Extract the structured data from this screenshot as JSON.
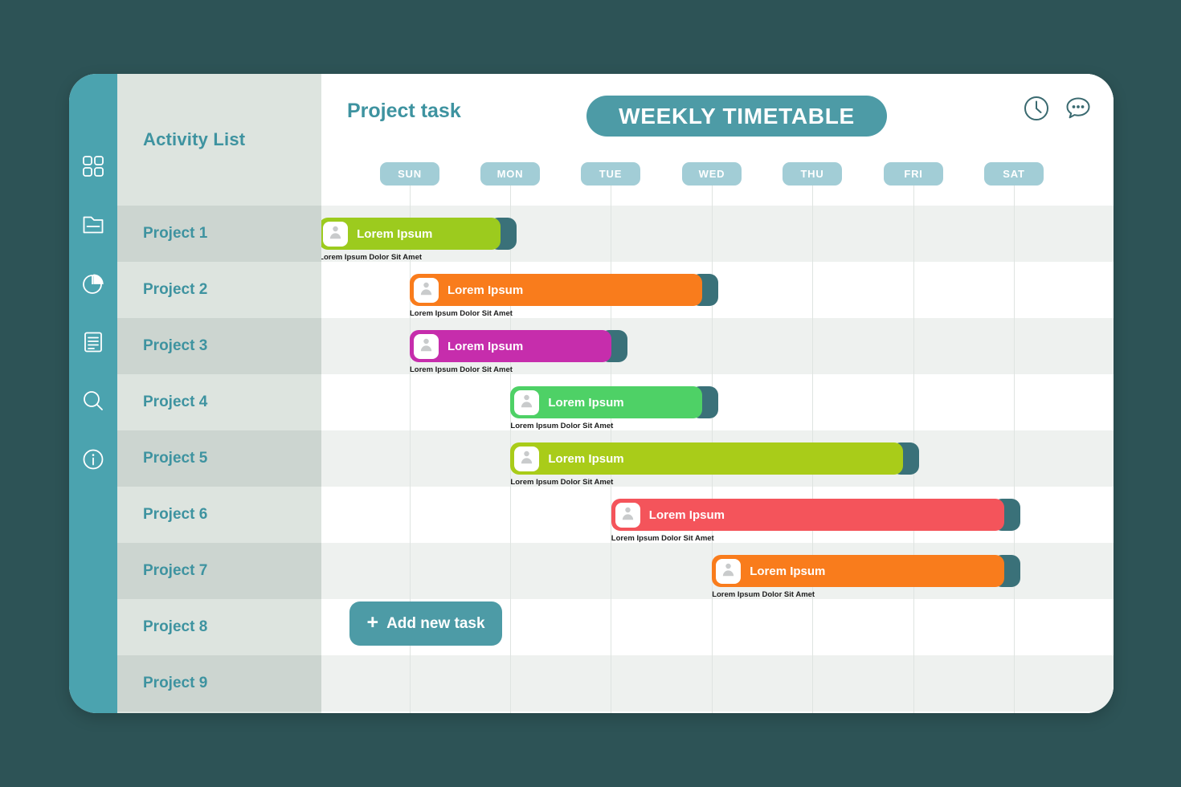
{
  "theme": {
    "page_bg": "#2d5356",
    "sidebar_bg": "#4ba3af",
    "accent": "#4d9ba6",
    "label_teal": "#3e93a0",
    "day_pill_bg": "#a2cdd6",
    "tail": "#3a7179"
  },
  "sidebar": {
    "items": [
      {
        "icon": "grid-icon",
        "name": "dashboard"
      },
      {
        "icon": "folder-icon",
        "name": "files"
      },
      {
        "icon": "pie-chart-icon",
        "name": "reports"
      },
      {
        "icon": "document-icon",
        "name": "documents"
      },
      {
        "icon": "search-icon",
        "name": "search"
      },
      {
        "icon": "info-icon",
        "name": "info"
      }
    ]
  },
  "activity": {
    "header": "Activity List",
    "projects": [
      "Project 1",
      "Project 2",
      "Project 3",
      "Project 4",
      "Project 5",
      "Project 6",
      "Project 7",
      "Project 8",
      "Project 9"
    ]
  },
  "header": {
    "title": "Project task",
    "banner": "WEEKLY TIMETABLE",
    "actions": [
      {
        "icon": "clock-icon",
        "name": "clock"
      },
      {
        "icon": "chat-dots-icon",
        "name": "comments"
      }
    ]
  },
  "days": [
    "SUN",
    "MON",
    "TUE",
    "WED",
    "THU",
    "FRI",
    "SAT"
  ],
  "tasks": [
    {
      "row": 0,
      "label": "Lorem Ipsum",
      "subtitle": "Lorem Ipsum Dolor Sit Amet",
      "color": "#9ccb1e",
      "start_day": -0.9,
      "end_day": 0.9
    },
    {
      "row": 1,
      "label": "Lorem Ipsum",
      "subtitle": "Lorem Ipsum Dolor Sit Amet",
      "color": "#f97c1c",
      "start_day": 0.0,
      "end_day": 2.9
    },
    {
      "row": 2,
      "label": "Lorem Ipsum",
      "subtitle": "Lorem Ipsum Dolor Sit Amet",
      "color": "#c62dac",
      "start_day": 0.0,
      "end_day": 2.0
    },
    {
      "row": 3,
      "label": "Lorem Ipsum",
      "subtitle": "Lorem Ipsum Dolor Sit Amet",
      "color": "#4ed166",
      "start_day": 1.0,
      "end_day": 2.9
    },
    {
      "row": 4,
      "label": "Lorem Ipsum",
      "subtitle": "Lorem Ipsum Dolor Sit Amet",
      "color": "#a9cc19",
      "start_day": 1.0,
      "end_day": 4.9
    },
    {
      "row": 5,
      "label": "Lorem Ipsum",
      "subtitle": "Lorem Ipsum Dolor Sit Amet",
      "color": "#f4545b",
      "start_day": 2.0,
      "end_day": 5.9
    },
    {
      "row": 6,
      "label": "Lorem Ipsum",
      "subtitle": "Lorem Ipsum Dolor Sit Amet",
      "color": "#f97c1c",
      "start_day": 3.0,
      "end_day": 5.9
    }
  ],
  "add_task": {
    "plus": "+",
    "label": "Add new task"
  },
  "chart_data": {
    "type": "bar",
    "title": "WEEKLY TIMETABLE",
    "xlabel": "",
    "ylabel": "Activity List",
    "categories": [
      "SUN",
      "MON",
      "TUE",
      "WED",
      "THU",
      "FRI",
      "SAT"
    ],
    "rows": [
      "Project 1",
      "Project 2",
      "Project 3",
      "Project 4",
      "Project 5",
      "Project 6",
      "Project 7",
      "Project 8",
      "Project 9"
    ],
    "series": [
      {
        "name": "Project 1",
        "label": "Lorem Ipsum",
        "color": "#9ccb1e",
        "span_days": [
          "SUN",
          "SUN"
        ]
      },
      {
        "name": "Project 2",
        "label": "Lorem Ipsum",
        "color": "#f97c1c",
        "span_days": [
          "MON",
          "WED"
        ]
      },
      {
        "name": "Project 3",
        "label": "Lorem Ipsum",
        "color": "#c62dac",
        "span_days": [
          "MON",
          "TUE"
        ]
      },
      {
        "name": "Project 4",
        "label": "Lorem Ipsum",
        "color": "#4ed166",
        "span_days": [
          "TUE",
          "WED"
        ]
      },
      {
        "name": "Project 5",
        "label": "Lorem Ipsum",
        "color": "#a9cc19",
        "span_days": [
          "TUE",
          "FRI"
        ]
      },
      {
        "name": "Project 6",
        "label": "Lorem Ipsum",
        "color": "#f4545b",
        "span_days": [
          "WED",
          "SAT"
        ]
      },
      {
        "name": "Project 7",
        "label": "Lorem Ipsum",
        "color": "#f97c1c",
        "span_days": [
          "THU",
          "SAT"
        ]
      },
      {
        "name": "Project 8",
        "label": "",
        "color": "",
        "span_days": []
      },
      {
        "name": "Project 9",
        "label": "",
        "color": "",
        "span_days": []
      }
    ]
  }
}
